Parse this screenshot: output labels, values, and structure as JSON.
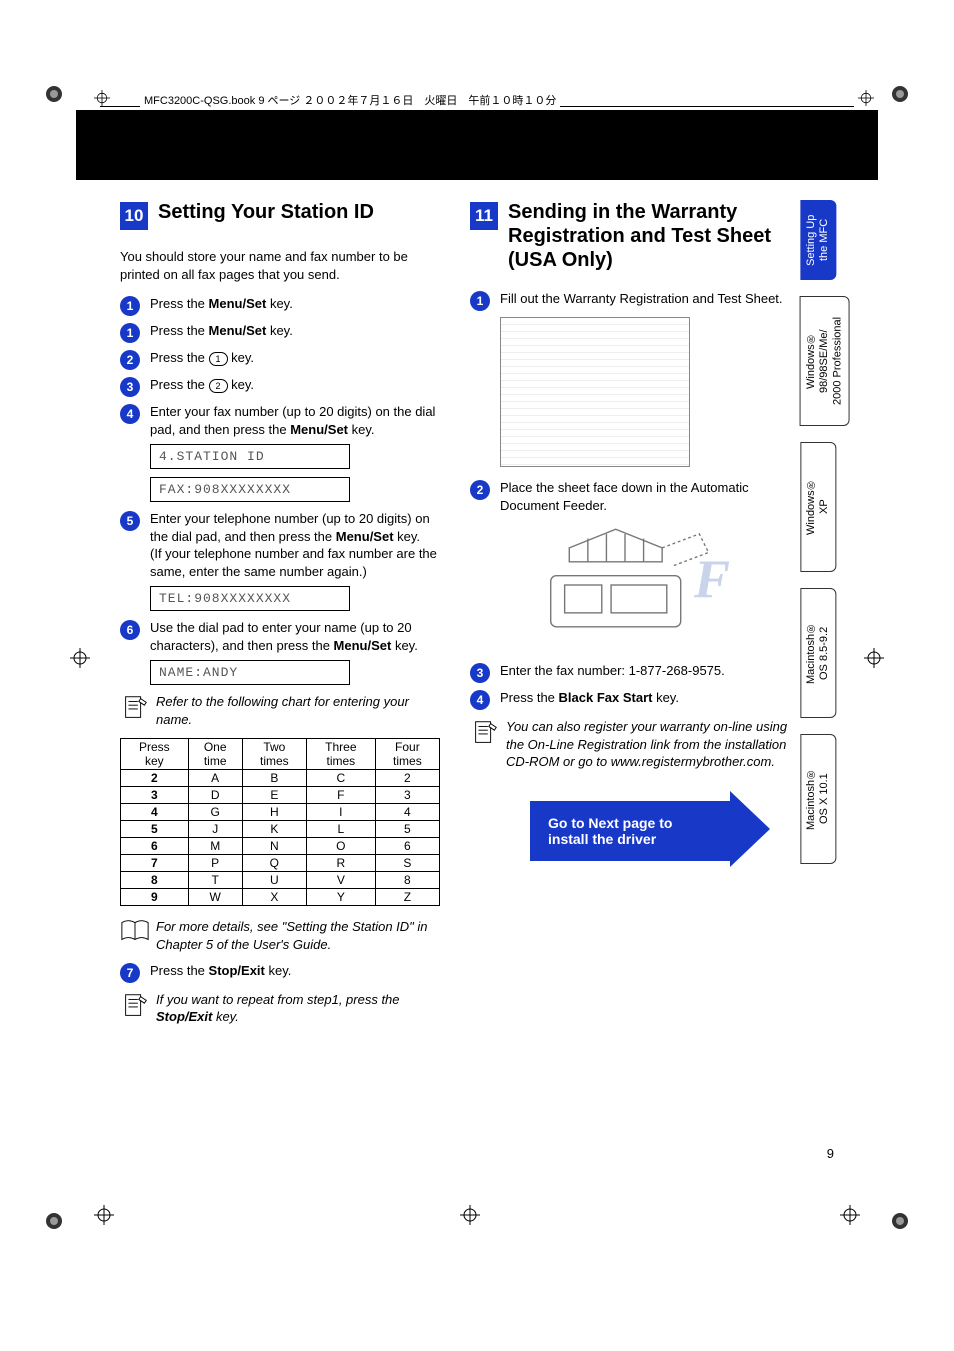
{
  "header_text": "MFC3200C-QSG.book 9 ページ ２００２年７月１６日　火曜日　午前１０時１０分",
  "section10": {
    "num": "10",
    "title": "Setting Your Station ID",
    "intro": "You should store your name and fax number to be printed on all fax pages that you send.",
    "s1a": "Press the ",
    "s1b": "Menu/Set",
    "s1c": " key.",
    "s2a": "Press the ",
    "s2b": "Menu/Set",
    "s2c": " key.",
    "k1": "1",
    "k2": "2",
    "s3": "Press the ",
    "s3end": " key.",
    "s4": "Press the ",
    "s4end": " key.",
    "s5a": "Enter your fax number (up to 20 digits) on the dial pad, and then press the ",
    "s5b": "Menu/Set",
    "s5c": " key.",
    "lcd1": "4.STATION ID",
    "lcd2": "FAX:908XXXXXXXX",
    "s6a": "Enter your telephone number (up to 20 digits) on the dial pad, and then press the ",
    "s6b": "Menu/Set",
    "s6c": " key.",
    "s6d": "(If your telephone number and fax number are the same, enter the same number again.)",
    "lcd3": "TEL:908XXXXXXXX",
    "s7a": "Use the dial pad to enter your name (up to 20 characters), and then press the ",
    "s7b": "Menu/Set",
    "s7c": " key.",
    "lcd4": "NAME:ANDY",
    "note1": "Refer to the following chart for entering your name.",
    "note2": "For more details, see \"Setting the Station ID\" in Chapter 5 of the User's Guide.",
    "s8a": "Press the ",
    "s8b": "Stop/Exit",
    "s8c": " key.",
    "note3a": "If you want to repeat from step1, press the ",
    "note3b": "Stop/Exit",
    "note3c": " key."
  },
  "chart_data": {
    "type": "table",
    "title": "Dial-pad character entry chart",
    "headers": [
      "Press key",
      "One time",
      "Two times",
      "Three times",
      "Four times"
    ],
    "rows": [
      [
        "2",
        "A",
        "B",
        "C",
        "2"
      ],
      [
        "3",
        "D",
        "E",
        "F",
        "3"
      ],
      [
        "4",
        "G",
        "H",
        "I",
        "4"
      ],
      [
        "5",
        "J",
        "K",
        "L",
        "5"
      ],
      [
        "6",
        "M",
        "N",
        "O",
        "6"
      ],
      [
        "7",
        "P",
        "Q",
        "R",
        "S"
      ],
      [
        "8",
        "T",
        "U",
        "V",
        "8"
      ],
      [
        "9",
        "W",
        "X",
        "Y",
        "Z"
      ]
    ]
  },
  "section11": {
    "num": "11",
    "title": "Sending in the Warranty Registration and Test Sheet (USA Only)",
    "s1": "Fill out the Warranty Registration and Test Sheet.",
    "s2": "Place the sheet face down in the Automatic Document Feeder.",
    "s3": "Enter the fax number: 1-877-268-9575.",
    "s4a": "Press the ",
    "s4b": "Black Fax Start",
    "s4c": " key.",
    "note": "You can also register your warranty on-line using the On-Line Registration link from the installation CD-ROM or go to www.registermybrother.com.",
    "goto": "Go to Next page to install the driver"
  },
  "tabs": {
    "t1a": "Setting Up",
    "t1b": "the MFC",
    "t2a": "Windows®",
    "t2b": "98/98SE/Me/",
    "t2c": "2000 Professional",
    "t3a": "Windows®",
    "t3b": "XP",
    "t4a": "Macintosh®",
    "t4b": "OS 8.5-9.2",
    "t5a": "Macintosh®",
    "t5b": "OS X 10.1"
  },
  "pagenum": "9"
}
